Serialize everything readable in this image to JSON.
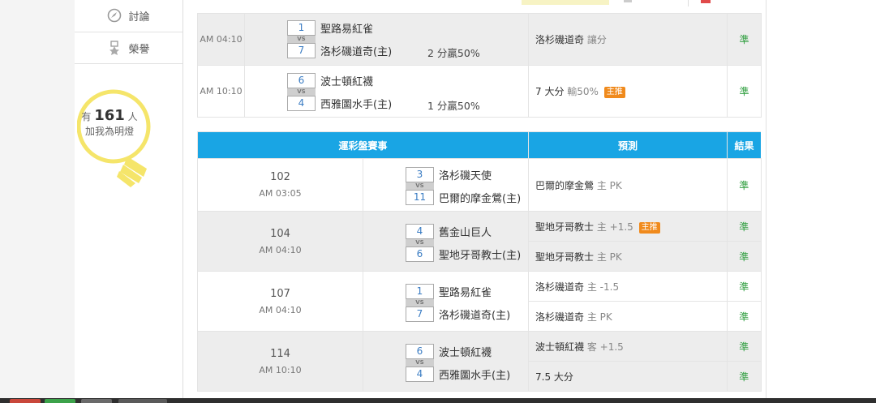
{
  "sidebar": {
    "menu": [
      {
        "label": "討論",
        "icon": "discussion-icon"
      },
      {
        "label": "榮譽",
        "icon": "medal-icon"
      }
    ],
    "bulb": {
      "prefix": "有",
      "count": "161",
      "suffix": "人",
      "line2": "加我為明燈"
    }
  },
  "top_table": {
    "rows": [
      {
        "time": "AM 04:10",
        "home_score": "1",
        "home": "聖路易紅雀",
        "away_score": "7",
        "away": "洛杉磯道奇(主)",
        "extra": "2 分贏50%",
        "pick_main": "洛杉磯道奇",
        "pick_sub": "讓分",
        "tag": "",
        "result": "準"
      },
      {
        "time": "AM 10:10",
        "home_score": "6",
        "home": "波士頓紅襪",
        "away_score": "4",
        "away": "西雅圖水手(主)",
        "extra": "1 分贏50%",
        "pick_main": "7 大分",
        "pick_sub": "輸50%",
        "tag": "主推",
        "result": "準"
      }
    ]
  },
  "lottery_table": {
    "headers": {
      "event": "運彩盤賽事",
      "prediction": "預測",
      "result": "結果"
    },
    "vs_label": "VS",
    "groups": [
      {
        "id": "102",
        "time": "AM 03:05",
        "home_score": "3",
        "home": "洛杉磯天使",
        "away_score": "11",
        "away": "巴爾的摩金鶯(主)",
        "picks": [
          {
            "main": "巴爾的摩金鶯",
            "sub": "主 PK",
            "tag": "",
            "result": "準"
          }
        ]
      },
      {
        "id": "104",
        "time": "AM 04:10",
        "home_score": "4",
        "home": "舊金山巨人",
        "away_score": "6",
        "away": "聖地牙哥教士(主)",
        "picks": [
          {
            "main": "聖地牙哥教士",
            "sub": "主 +1.5",
            "tag": "主推",
            "result": "準"
          },
          {
            "main": "聖地牙哥教士",
            "sub": "主 PK",
            "tag": "",
            "result": "準"
          }
        ]
      },
      {
        "id": "107",
        "time": "AM 04:10",
        "home_score": "1",
        "home": "聖路易紅雀",
        "away_score": "7",
        "away": "洛杉磯道奇(主)",
        "picks": [
          {
            "main": "洛杉磯道奇",
            "sub": "主 -1.5",
            "tag": "",
            "result": "準"
          },
          {
            "main": "洛杉磯道奇",
            "sub": "主 PK",
            "tag": "",
            "result": "準"
          }
        ]
      },
      {
        "id": "114",
        "time": "AM 10:10",
        "home_score": "6",
        "home": "波士頓紅襪",
        "away_score": "4",
        "away": "西雅圖水手(主)",
        "picks": [
          {
            "main": "波士頓紅襪",
            "sub": "客 +1.5",
            "tag": "",
            "result": "準"
          },
          {
            "main": "7.5 大分",
            "sub": "",
            "tag": "",
            "result": "準"
          }
        ]
      }
    ]
  },
  "colors": {
    "header": "#19a5e4",
    "result": "#2e9e3e",
    "tag": "#f08a1c",
    "score": "#3a7cc3"
  }
}
